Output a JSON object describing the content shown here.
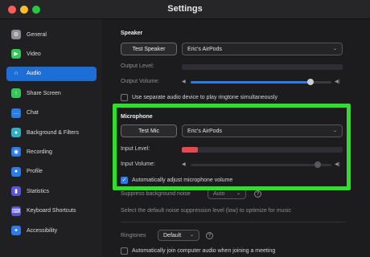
{
  "window": {
    "title": "Settings"
  },
  "sidebar": {
    "items": [
      {
        "label": "General",
        "icon": "gear-icon",
        "color": "#8e8e93"
      },
      {
        "label": "Video",
        "icon": "video-camera-icon",
        "color": "#34c759"
      },
      {
        "label": "Audio",
        "icon": "headphones-icon",
        "color": "#1d6fd6",
        "active": true
      },
      {
        "label": "Share Screen",
        "icon": "share-screen-icon",
        "color": "#34c759"
      },
      {
        "label": "Chat",
        "icon": "chat-bubble-icon",
        "color": "#2d7be6"
      },
      {
        "label": "Background & Filters",
        "icon": "person-background-icon",
        "color": "#30b0c7"
      },
      {
        "label": "Recording",
        "icon": "record-icon",
        "color": "#2d7be6"
      },
      {
        "label": "Profile",
        "icon": "profile-icon",
        "color": "#2d7be6"
      },
      {
        "label": "Statistics",
        "icon": "bar-chart-icon",
        "color": "#5856d6"
      },
      {
        "label": "Keyboard Shortcuts",
        "icon": "keyboard-icon",
        "color": "#5856d6"
      },
      {
        "label": "Accessibility",
        "icon": "accessibility-icon",
        "color": "#2d7be6"
      }
    ]
  },
  "speaker": {
    "title": "Speaker",
    "test_button": "Test Speaker",
    "device": "Eric's AirPods",
    "output_level_label": "Output Level:",
    "output_volume_label": "Output Volume:",
    "output_volume": 0.85
  },
  "ringtone_device": {
    "label": "Use separate audio device to play ringtone simultaneously",
    "checked": false
  },
  "microphone": {
    "title": "Microphone",
    "test_button": "Test Mic",
    "device": "Eric's AirPods",
    "input_level_label": "Input Level:",
    "input_level": 0.1,
    "input_volume_label": "Input Volume:",
    "input_volume": 0.9,
    "auto_adjust": {
      "label": "Automatically adjust microphone volume",
      "checked": true
    }
  },
  "noise": {
    "label": "Suppress background noise",
    "value": "Auto",
    "hint": "Select the default noise suppression level (low) to optimize for music"
  },
  "ringtones": {
    "label": "Ringtones",
    "value": "Default"
  },
  "auto_join": {
    "label": "Automatically join computer audio when joining a meeting",
    "checked": false
  },
  "colors": {
    "accent": "#2d7be6",
    "highlight": "#2fe02a",
    "level": "#e5484d"
  },
  "glyphs": {
    "chevron": "⌄",
    "check": "✓",
    "help": "?",
    "speaker_low": "◀",
    "speaker_high": "◀)"
  }
}
